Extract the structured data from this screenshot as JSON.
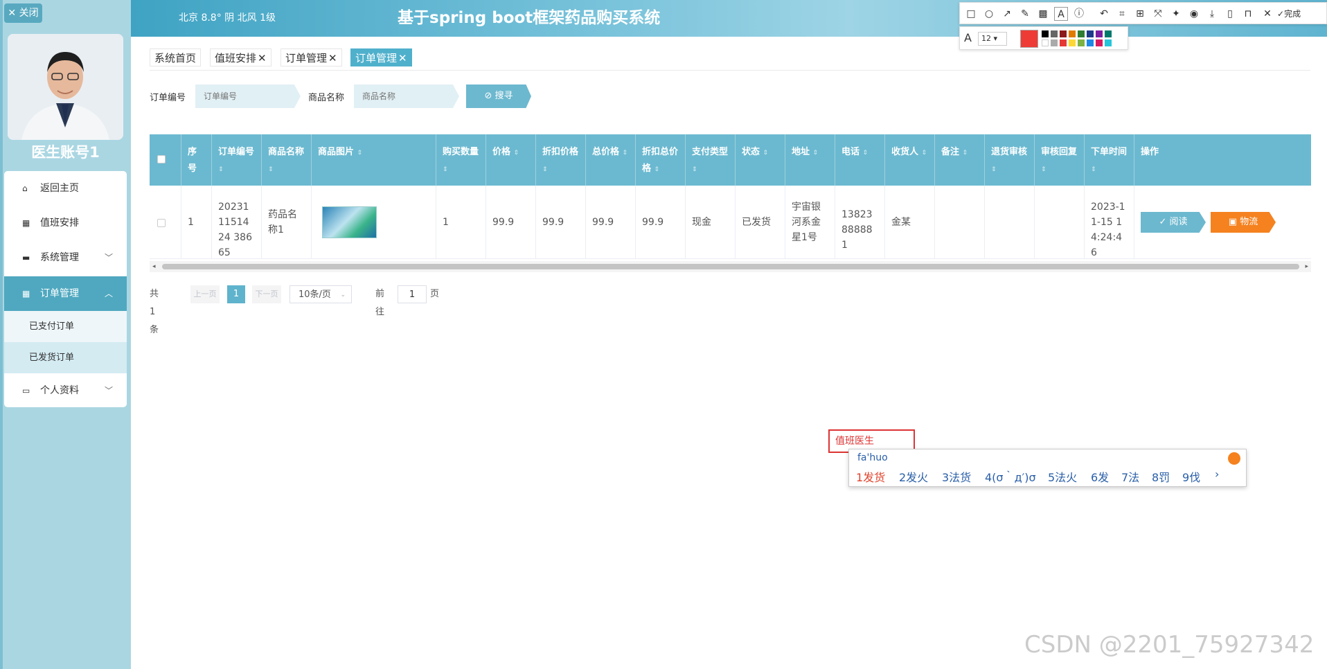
{
  "sidebar": {
    "close_label": "✕ 关闭",
    "doctor_name": "医生账号1",
    "items": [
      {
        "label": "返回主页",
        "icon": "home-icon"
      },
      {
        "label": "值班安排",
        "icon": "grid-icon"
      },
      {
        "label": "系统管理",
        "icon": "monitor-icon"
      },
      {
        "label": "订单管理",
        "icon": "grid-icon"
      },
      {
        "label": "个人资料",
        "icon": "card-icon"
      }
    ],
    "sub_items": [
      "已支付订单",
      "已发货订单"
    ]
  },
  "header": {
    "weather": "北京  8.8°  阴  北风  1级",
    "title": "基于spring boot框架药品购买系统"
  },
  "tabs": [
    {
      "label": "系统首页",
      "closable": false
    },
    {
      "label": "值班安排",
      "closable": true
    },
    {
      "label": "订单管理",
      "closable": true
    },
    {
      "label": "订单管理",
      "closable": true
    }
  ],
  "search": {
    "order_no_label": "订单编号",
    "order_no_placeholder": "订单编号",
    "product_label": "商品名称",
    "product_placeholder": "商品名称",
    "button": "搜寻"
  },
  "table": {
    "headers": [
      "序号",
      "订单编号",
      "商品名称",
      "商品图片",
      "购买数量",
      "价格",
      "折扣价格",
      "总价格",
      "折扣总价格",
      "支付类型",
      "状态",
      "地址",
      "电话",
      "收货人",
      "备注",
      "退货审核",
      "审核回复",
      "下单时间",
      "操作"
    ],
    "row": {
      "index": "1",
      "order_no": "202311151424 38665",
      "product": "药品名称1",
      "qty": "1",
      "price": "99.9",
      "discount_price": "99.9",
      "total": "99.9",
      "discount_total": "99.9",
      "pay_type": "现金",
      "status": "已发货",
      "address": "宇宙银河系金星1号",
      "phone": "13823888881",
      "receiver": "金某",
      "remark": "",
      "return_review": "",
      "review_reply": "",
      "order_time": "2023-11-15 14:24:46"
    },
    "actions": [
      "阅读",
      "物流"
    ]
  },
  "pager": {
    "total": "共 1 条",
    "prev": "上一页",
    "current": "1",
    "next": "下一页",
    "size": "10条/页",
    "goto": "前往",
    "goto_value": "1",
    "page_unit": "页"
  },
  "toolbar": {
    "font_size": "12",
    "done": "完成"
  },
  "overlay": {
    "textbox": "值班医生",
    "ime_composition": "fa'huo",
    "candidates": [
      "1发货",
      "2发火",
      "3法货",
      "4(σ｀д′)σ",
      "5法火",
      "6发",
      "7法",
      "8罚",
      "9伐"
    ]
  },
  "watermark": "CSDN @2201_75927342",
  "colors": {
    "accent": "#5fb3cc",
    "header": "#3fa3c3",
    "logistics": "#f5821f",
    "read": "#6cb8cf"
  }
}
